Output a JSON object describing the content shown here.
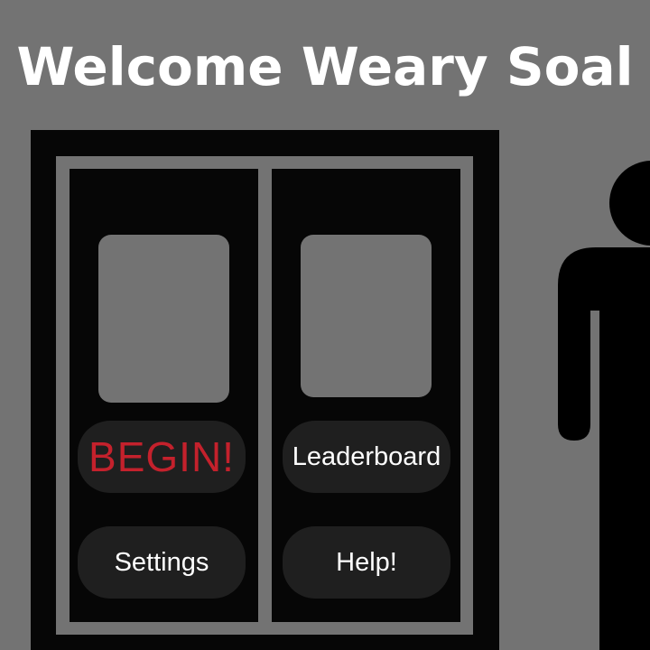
{
  "title": "Welcome Weary Soal",
  "buttons": {
    "begin": "BEGIN!",
    "leaderboard": "Leaderboard",
    "settings": "Settings",
    "help": "Help!"
  },
  "colors": {
    "background": "#737373",
    "cabinet": "#060606",
    "button": "#1f1f1f",
    "begin_text": "#c4212c",
    "text": "#ffffff"
  },
  "icons": {
    "figure": "person-silhouette-icon"
  }
}
